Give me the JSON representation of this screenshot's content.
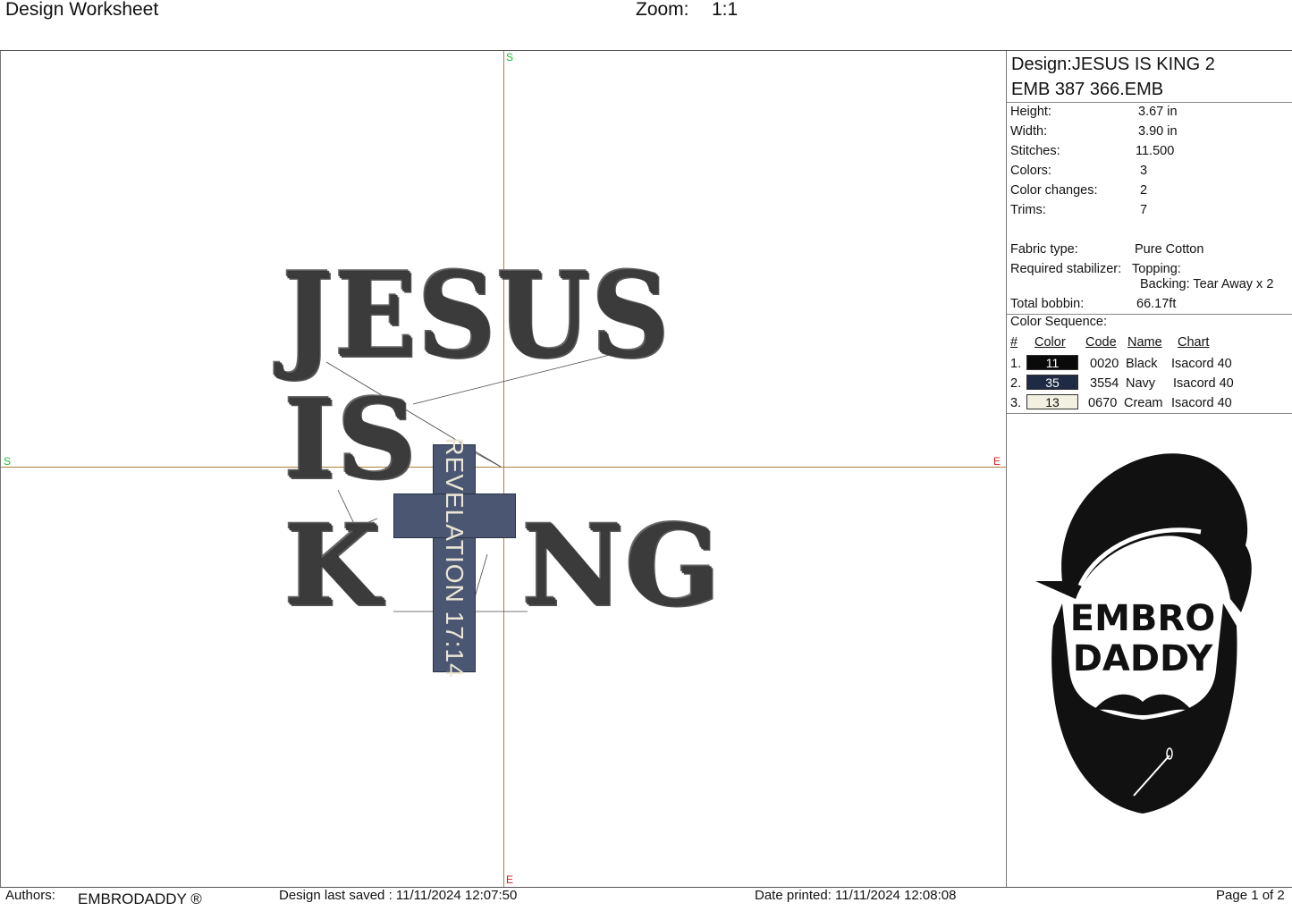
{
  "header": {
    "title": "Design Worksheet",
    "zoom_label": "Zoom:",
    "zoom_value": "1:1"
  },
  "canvas": {
    "axis_labels": {
      "top": "S",
      "left": "S",
      "right": "E",
      "bottom": "E"
    },
    "design_lines": [
      "JESUS",
      "IS",
      "K",
      "NG"
    ],
    "cross_text": "REVELATION 17:14",
    "colors": {
      "axis": "#b07e3e",
      "start_marker": "#18c02a",
      "end_marker": "#d61b1b",
      "stitch": "#3b3b3b",
      "cross_fill": "#4a5672"
    }
  },
  "info": {
    "design_name": "Design:JESUS IS KING 2",
    "file_name": "EMB 387 366.EMB",
    "rows": [
      {
        "label": "Height:",
        "value": "3.67 in"
      },
      {
        "label": "Width:",
        "value": "3.90 in"
      },
      {
        "label": "Stitches:",
        "value": "11.500"
      },
      {
        "label": "Colors:",
        "value": "3"
      },
      {
        "label": "Color changes:",
        "value": "2"
      },
      {
        "label": "Trims:",
        "value": "7"
      }
    ],
    "fabric_label": "Fabric type:",
    "fabric_value": "Pure Cotton",
    "stabilizer_label": "Required stabilizer:",
    "topping": "Topping:",
    "backing": "Backing: Tear Away x 2",
    "bobbin_label": "Total bobbin:",
    "bobbin_value": "66.17ft"
  },
  "color_sequence": {
    "title": "Color Sequence:",
    "headers": {
      "num": "#",
      "color": "Color",
      "code": "Code",
      "name": "Name",
      "chart": "Chart"
    },
    "rows": [
      {
        "num": "1.",
        "swatch": "11",
        "swatch_color": "#0a0a0a",
        "text_color": "#ffffff",
        "code": "0020",
        "name": "Black",
        "chart": "Isacord 40"
      },
      {
        "num": "2.",
        "swatch": "35",
        "swatch_color": "#1f2a44",
        "text_color": "#ffffff",
        "code": "3554",
        "name": "Navy",
        "chart": "Isacord 40"
      },
      {
        "num": "3.",
        "swatch": "13",
        "swatch_color": "#f2f0e0",
        "text_color": "#111111",
        "code": "0670",
        "name": "Cream",
        "chart": "Isacord 40"
      }
    ]
  },
  "logo": {
    "line1": "EMBRO",
    "line2": "DADDY"
  },
  "footer": {
    "authors_label": "Authors:",
    "authors_value": "EMBRODADDY ®",
    "saved": "Design last saved : 11/11/2024 12:07:50",
    "printed": "Date printed: 11/11/2024 12:08:08",
    "page": "Page 1 of 2"
  }
}
